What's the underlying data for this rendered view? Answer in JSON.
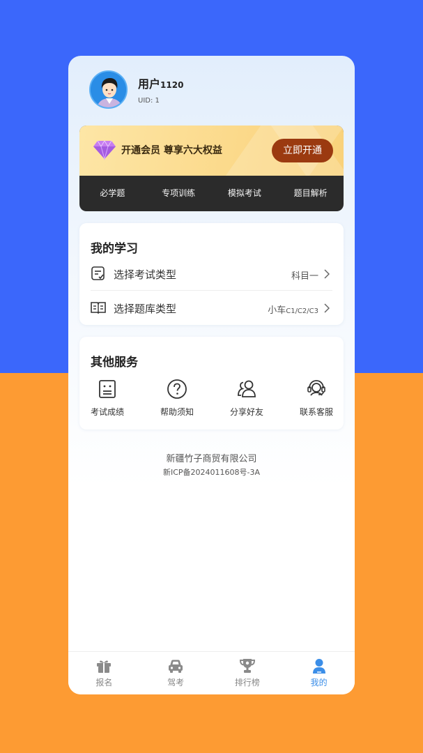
{
  "profile": {
    "name_prefix": "用户",
    "name_number": "1120",
    "uid": "UID: 1",
    "avatar": "avatar-boy"
  },
  "vip": {
    "icon": "diamond-icon",
    "title": "开通会员 尊享六大权益",
    "button": "立即开通",
    "tabs": [
      "必学题",
      "专项训练",
      "模拟考试",
      "题目解析"
    ]
  },
  "study": {
    "title": "我的学习",
    "rows": [
      {
        "label": "选择考试类型",
        "value": "科目一",
        "value_small": "",
        "icon": "exam-doc-icon"
      },
      {
        "label": "选择题库类型",
        "value": "小车",
        "value_small": "C1/C2/C3",
        "icon": "book-open-icon"
      }
    ]
  },
  "services": {
    "title": "其他服务",
    "items": [
      {
        "label": "考试成绩",
        "icon": "score-sheet-icon"
      },
      {
        "label": "帮助须知",
        "icon": "help-circle-icon"
      },
      {
        "label": "分享好友",
        "icon": "users-icon"
      },
      {
        "label": "联系客服",
        "icon": "headset-icon"
      }
    ]
  },
  "footer": {
    "company": "新疆竹子商贸有限公司",
    "icp": "新ICP备2024011608号-3A"
  },
  "tabbar": {
    "items": [
      {
        "label": "报名",
        "icon": "gift-icon"
      },
      {
        "label": "驾考",
        "icon": "car-icon"
      },
      {
        "label": "排行榜",
        "icon": "trophy-icon"
      },
      {
        "label": "我的",
        "icon": "person-icon"
      }
    ],
    "active_index": 3
  },
  "colors": {
    "bg_top": "#3b67fb",
    "bg_bottom": "#fd9b33",
    "vip_button": "#9b3a10",
    "active_tab": "#3b8ee8"
  }
}
